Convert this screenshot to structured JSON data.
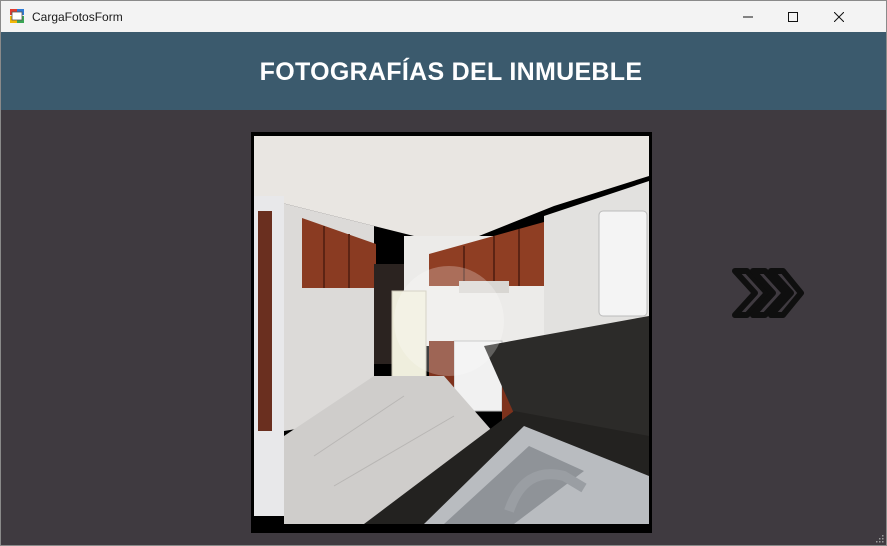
{
  "window": {
    "title": "CargaFotosForm",
    "controls": [
      "minimize",
      "maximize",
      "close"
    ]
  },
  "header": {
    "title": "FOTOGRAFÍAS DEL INMUEBLE",
    "background": "#3b5a6d"
  },
  "body": {
    "background": "#3f3a40"
  },
  "photo": {
    "subject": "kitchen interior photo"
  },
  "next_button": {
    "icon": "double-chevron-right-icon"
  }
}
